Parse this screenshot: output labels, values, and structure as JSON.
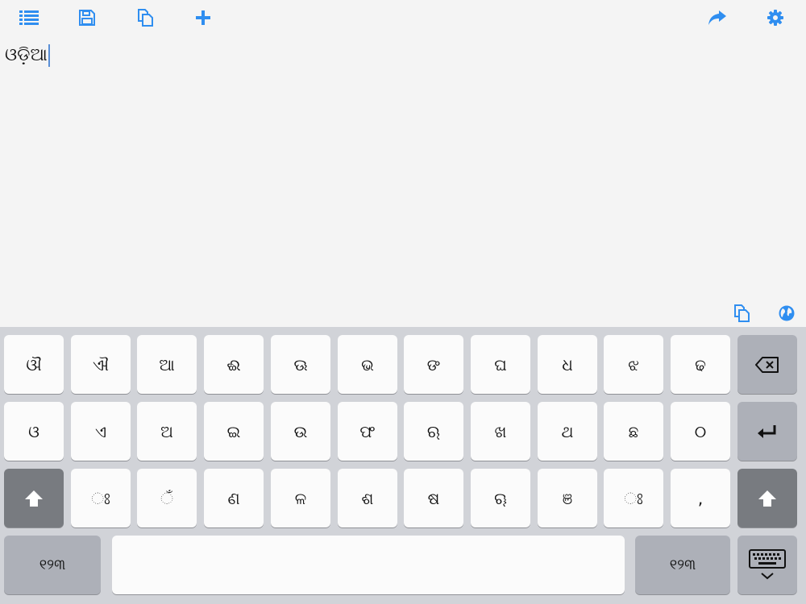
{
  "toolbar": {
    "icons": [
      "list-icon",
      "save-icon",
      "copy-icon",
      "plus-icon",
      "share-icon",
      "gear-icon"
    ],
    "accent": "#2f8ef0"
  },
  "editor": {
    "text": "ଓଡ଼ିଆ"
  },
  "accessory": {
    "icons": [
      "copy-icon",
      "globe-icon"
    ]
  },
  "keyboard": {
    "row1": [
      "ଔ",
      "ଐ",
      "ଆ",
      "ଈ",
      "ଊ",
      "ଭ",
      "ଙ",
      "ଘ",
      "ଧ",
      "ଝ",
      "ଢ"
    ],
    "row2": [
      "ଓ",
      "ଏ",
      "ଅ",
      "ଇ",
      "ଉ",
      "ଫ",
      "ଋ",
      "ଖ",
      "ଥ",
      "ଛ",
      "୦"
    ],
    "row3": [
      "ଃ",
      "ଁ",
      "ଣ",
      "ଳ",
      "ଶ",
      "ଷ",
      "ୠ",
      "ଞ",
      "ଃ",
      ","
    ],
    "number_key_left": "୧୨୩",
    "number_key_right": "୧୨୩",
    "space_label": ""
  }
}
